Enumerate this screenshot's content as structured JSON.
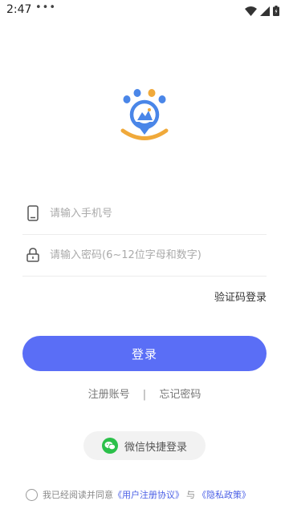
{
  "status_bar": {
    "time": "2:47",
    "dots": "•••",
    "icons": [
      "wifi-icon",
      "signal-icon",
      "battery-icon"
    ]
  },
  "logo": {
    "icon": "paw-location-logo",
    "colors": {
      "blue": "#4a86e8",
      "orange": "#f0a93a"
    }
  },
  "phone": {
    "placeholder": "请输入手机号",
    "icon": "phone-icon"
  },
  "password": {
    "placeholder": "请输入密码(6~12位字母和数字)",
    "icon": "lock-icon"
  },
  "sms_login_label": "验证码登录",
  "login_button_label": "登录",
  "links": {
    "register": "注册账号",
    "separator": "|",
    "forgot": "忘记密码"
  },
  "wechat": {
    "label": "微信快捷登录",
    "icon": "wechat-icon"
  },
  "agreement": {
    "prefix": "我已经阅读并同意",
    "user_agreement": "《用户注册协议》",
    "and": "与",
    "privacy": "《隐私政策》"
  },
  "colors": {
    "accent": "#5a6ef6",
    "wechat": "#2bc04a",
    "link": "#4a5fe6"
  }
}
